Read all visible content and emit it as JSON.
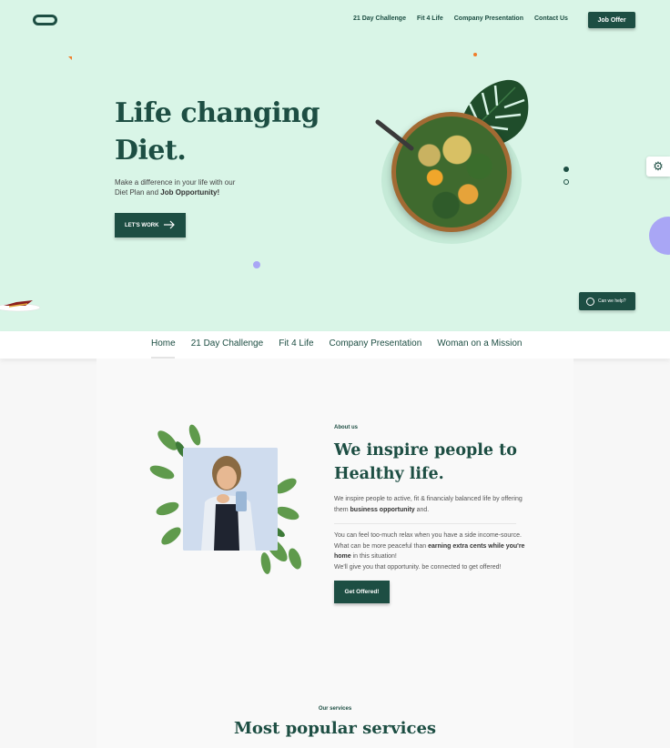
{
  "header": {
    "nav": [
      "21 Day Challenge",
      "Fit 4 Life",
      "Company Presentation",
      "Contact Us"
    ],
    "job_offer_label": "Job Offer"
  },
  "hero": {
    "title_line1": "Life changing",
    "title_line2": "Diet.",
    "subtitle_line1": "Make a difference in your life with our",
    "subtitle_line2_prefix": "Diet Plan and ",
    "subtitle_line2_bold": "Job Opportunity!",
    "cta_label": "LET'S WORK",
    "help_label": "Can we help?"
  },
  "subnav": {
    "items": [
      "Home",
      "21 Day Challenge",
      "Fit 4 Life",
      "Company Presentation",
      "Woman on a Mission"
    ]
  },
  "about": {
    "tag": "About us",
    "title_line1": "We inspire people to",
    "title_line2": "Healthy life.",
    "p1_prefix": "We inspire people to active, fit & financialy balanced life by offering them ",
    "p1_bold": "business opportunity",
    "p1_suffix": " and.",
    "p2_line1": "You can feel too-much relax when you have a side income-source.",
    "p2_prefix": "What can be more peaceful than ",
    "p2_bold": "earning extra cents while you're home",
    "p2_suffix": " in this situation!",
    "p2_line4": "We'll give you that opportunity. be connected to get offered!",
    "cta_label": "Get Offered!"
  },
  "services": {
    "tag": "Our services",
    "title": "Most popular services"
  },
  "colors": {
    "brand": "#1d4e43",
    "hero_bg": "#d9f5e7",
    "accent_purple": "#a9a6f5",
    "accent_orange": "#f07d2a"
  }
}
